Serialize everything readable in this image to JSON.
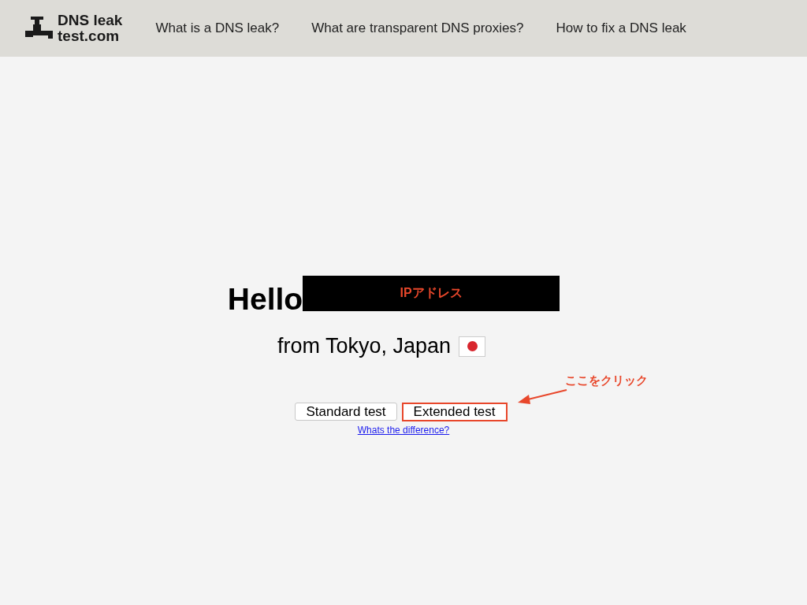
{
  "header": {
    "logo": {
      "line_1": "DNS leak",
      "line_2": "test.com"
    },
    "nav": [
      {
        "label": "What is a DNS leak?"
      },
      {
        "label": "What are transparent DNS proxies?"
      },
      {
        "label": "How to fix a DNS leak"
      }
    ]
  },
  "greeting": {
    "hello": "Hello",
    "redaction_label": "IPアドレス",
    "location": "from Tokyo, Japan"
  },
  "buttons": [
    {
      "label": "Standard test",
      "highlighted": false
    },
    {
      "label": "Extended test",
      "highlighted": true
    }
  ],
  "difference_link": "Whats the difference?",
  "annotation": {
    "label": "ここをクリック"
  }
}
